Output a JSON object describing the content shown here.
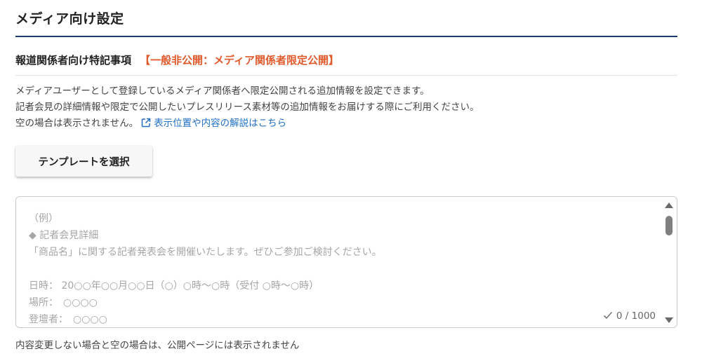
{
  "section": {
    "title": "メディア向け設定"
  },
  "subsection": {
    "title": "報道関係者向け特記事項",
    "visibility_tag": "【一般非公開：メディア関係者限定公開】"
  },
  "description": {
    "line1": "メディアユーザーとして登録しているメディア関係者へ限定公開される追加情報を設定できます。",
    "line2": "記者会見の詳細情報や限定で公開したいプレスリリース素材等の追加情報をお届けする際にご利用ください。",
    "line3": "空の場合は表示されません。",
    "link_label": "表示位置や内容の解説はこちら",
    "link_icon": "external-link-icon"
  },
  "template_button": {
    "label": "テンプレートを選択"
  },
  "textarea": {
    "placeholder_lines": [
      "（例）",
      "◆ 記者会見詳細",
      "「商品名」に関する記者発表会を開催いたします。ぜひご参加ご検討ください。",
      "",
      "日時： 20○○年○○月○○日（○）○時～○時（受付 ○時～○時）",
      "場所：　○○○○",
      "登壇者：　○○○○"
    ],
    "counter": "0 / 1000",
    "counter_icon": "check-icon"
  },
  "footnote": "内容変更しない場合と空の場合は、公開ページには表示されません",
  "colors": {
    "accent_rule": "#1f3a6e",
    "tag": "#e05a2b",
    "link": "#1f6fc4"
  }
}
